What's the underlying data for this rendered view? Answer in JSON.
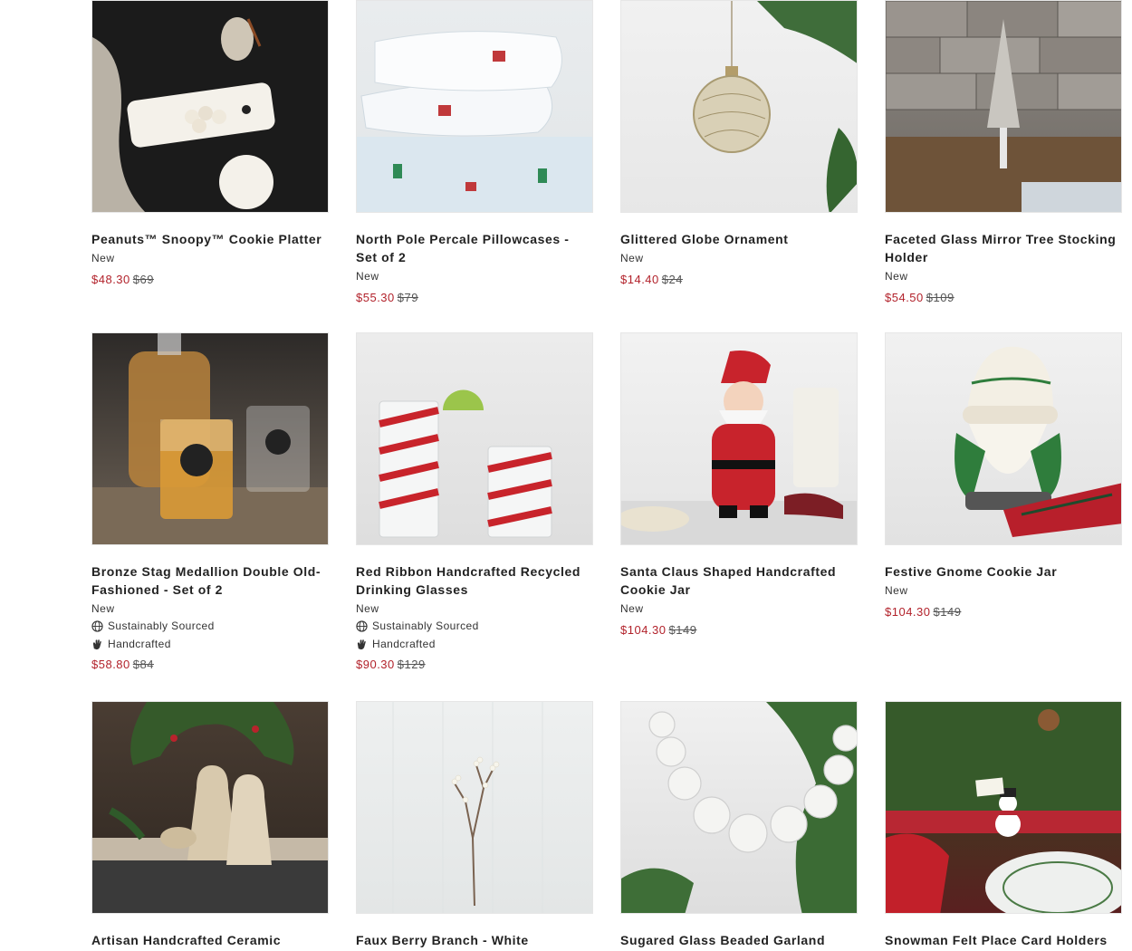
{
  "products": [
    {
      "title": "Peanuts™ Snoopy™ Cookie Platter",
      "tag": "New",
      "badges": [],
      "sale": "$48.30",
      "orig": "$69"
    },
    {
      "title": "North Pole Percale Pillowcases - Set of 2",
      "tag": "New",
      "badges": [],
      "sale": "$55.30",
      "orig": "$79"
    },
    {
      "title": "Glittered Globe Ornament",
      "tag": "New",
      "badges": [],
      "sale": "$14.40",
      "orig": "$24"
    },
    {
      "title": "Faceted Glass Mirror Tree Stocking Holder",
      "tag": "New",
      "badges": [],
      "sale": "$54.50",
      "orig": "$109"
    },
    {
      "title": "Bronze Stag Medallion Double Old-Fashioned - Set of 2",
      "tag": "New",
      "badges": [
        "Sustainably Sourced",
        "Handcrafted"
      ],
      "sale": "$58.80",
      "orig": "$84"
    },
    {
      "title": "Red Ribbon Handcrafted Recycled Drinking Glasses",
      "tag": "New",
      "badges": [
        "Sustainably Sourced",
        "Handcrafted"
      ],
      "sale": "$90.30",
      "orig": "$129"
    },
    {
      "title": "Santa Claus Shaped Handcrafted Cookie Jar",
      "tag": "New",
      "badges": [],
      "sale": "$104.30",
      "orig": "$149"
    },
    {
      "title": "Festive Gnome Cookie Jar",
      "tag": "New",
      "badges": [],
      "sale": "$104.30",
      "orig": "$149"
    },
    {
      "title": "Artisan Handcrafted Ceramic",
      "tag": "",
      "badges": [],
      "sale": "",
      "orig": ""
    },
    {
      "title": "Faux Berry Branch - White",
      "tag": "",
      "badges": [],
      "sale": "",
      "orig": ""
    },
    {
      "title": "Sugared Glass Beaded Garland",
      "tag": "",
      "badges": [],
      "sale": "",
      "orig": ""
    },
    {
      "title": "Snowman Felt Place Card Holders",
      "tag": "",
      "badges": [],
      "sale": "",
      "orig": ""
    }
  ],
  "badge_icons": {
    "Sustainably Sourced": "globe-icon",
    "Handcrafted": "hand-icon"
  },
  "colors": {
    "sale": "#b2222b",
    "text": "#222222"
  }
}
